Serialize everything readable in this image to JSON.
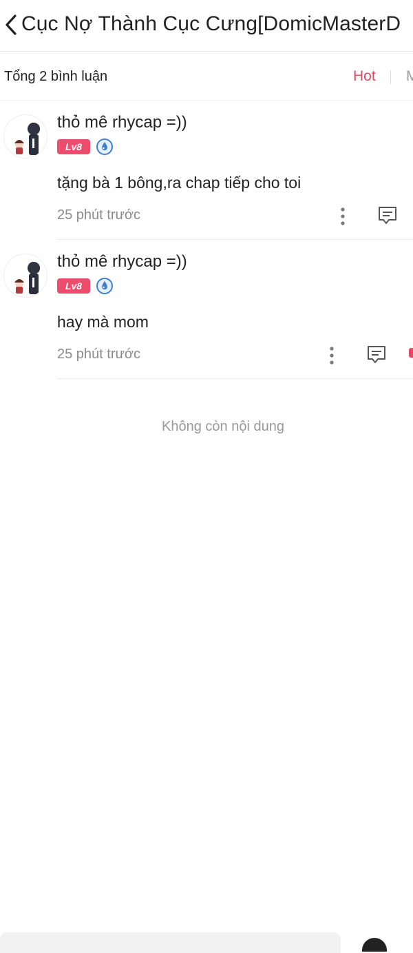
{
  "header": {
    "title": "Cục Nợ Thành Cục Cưng[DomicMasterD"
  },
  "summary": {
    "total_comments": "Tổng 2 bình luận",
    "sort_hot": "Hot",
    "sort_new": "M"
  },
  "comments": [
    {
      "username": "thỏ mê rhycap =))",
      "level": "Lv8",
      "text": "tặng bà 1 bông,ra chap tiếp cho toi",
      "time": "25 phút trước"
    },
    {
      "username": "thỏ mê rhycap =))",
      "level": "Lv8",
      "text": "hay mà mom",
      "time": "25 phút trước"
    }
  ],
  "footer": {
    "no_more": "Không còn nội dung"
  },
  "colors": {
    "accent": "#e54863",
    "level_badge": "#ec4d6c",
    "rank_icon": "#3d7fd0",
    "muted_text": "#8a8a8a"
  },
  "icons": {
    "back": "chevron-left-icon",
    "more": "more-vertical-icon",
    "reply": "comment-reply-icon",
    "rank": "water-drop-rank-icon"
  }
}
